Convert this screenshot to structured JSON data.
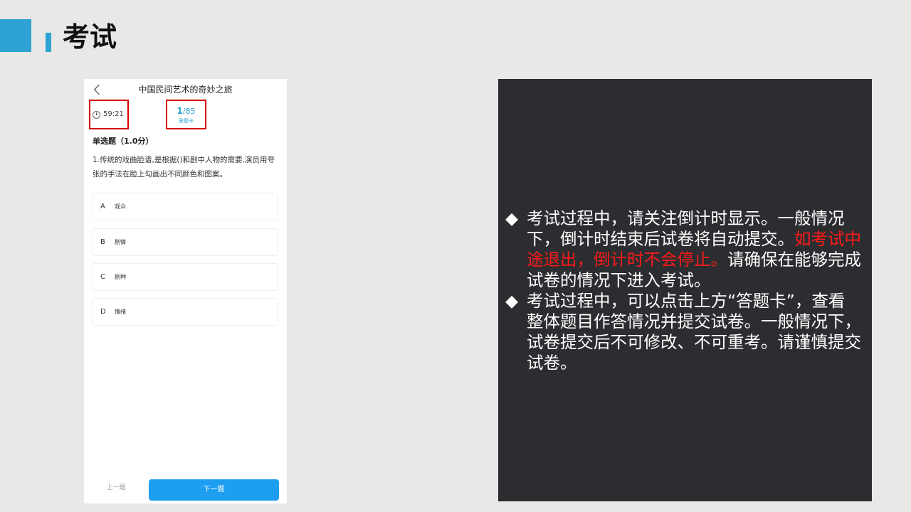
{
  "header": {
    "title": "考试",
    "accent_color": "#2ea3d3"
  },
  "phone": {
    "nav_title": "中国民间艺术的奇妙之旅",
    "back_icon": "chevron-left-icon",
    "timer": "59:21",
    "timer_icon": "clock-icon",
    "card_current": "1",
    "card_total": "/85",
    "card_label": "答题卡",
    "question_type": "单选题（1.0分）",
    "question_text": "1.传统的戏曲脸谱,是根据()和剧中人物的需要,演员用夸张的手法在脸上勾画出不同颜色和图案。",
    "options": [
      {
        "letter": "A",
        "text": "观众"
      },
      {
        "letter": "B",
        "text": "剧情"
      },
      {
        "letter": "C",
        "text": "剧种"
      },
      {
        "letter": "D",
        "text": "情绪"
      }
    ],
    "prev_label": "上一题",
    "next_label": "下一题",
    "next_color": "#1e9ef0",
    "highlight_color": "#d60000"
  },
  "panel": {
    "bullet_symbol": "◆",
    "bullet1_part1": "考试过程中，请关注倒计时显示。一般情况下，倒计时结束后试卷将自动提交。",
    "bullet1_red": "如考试中途退出，倒计时不会停止。",
    "bullet1_part2": "请确保在能够完成试卷的情况下进入考试。",
    "bullet2": "考试过程中，可以点击上方“答题卡”，查看整体题目作答情况并提交试卷。一般情况下，试卷提交后不可修改、不可重考。请谨慎提交试卷。",
    "warning_color": "#ff1a1a"
  }
}
